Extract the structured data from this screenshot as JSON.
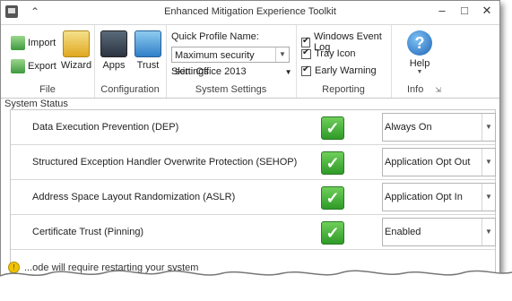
{
  "window": {
    "title": "Enhanced Mitigation Experience Toolkit"
  },
  "ribbon": {
    "file": {
      "import": "Import",
      "export": "Export",
      "wizard": "Wizard",
      "label": "File"
    },
    "configuration": {
      "apps": "Apps",
      "trust": "Trust",
      "label": "Configuration"
    },
    "system_settings": {
      "quick_profile_label": "Quick Profile Name:",
      "quick_profile_value": "Maximum security settings",
      "skin_label": "Skin: Office 2013",
      "label": "System Settings"
    },
    "reporting": {
      "windows_event_log": "Windows Event Log",
      "tray_icon": "Tray Icon",
      "early_warning": "Early Warning",
      "label": "Reporting"
    },
    "info": {
      "help": "Help",
      "label": "Info"
    }
  },
  "system_status": {
    "title": "System Status",
    "rows": [
      {
        "label": "Data Execution Prevention (DEP)",
        "value": "Always On"
      },
      {
        "label": "Structured Exception Handler Overwrite Protection (SEHOP)",
        "value": "Application Opt Out"
      },
      {
        "label": "Address Space Layout Randomization (ASLR)",
        "value": "Application Opt In"
      },
      {
        "label": "Certificate Trust (Pinning)",
        "value": "Enabled"
      }
    ]
  },
  "notice": "...ode will require restarting your system"
}
